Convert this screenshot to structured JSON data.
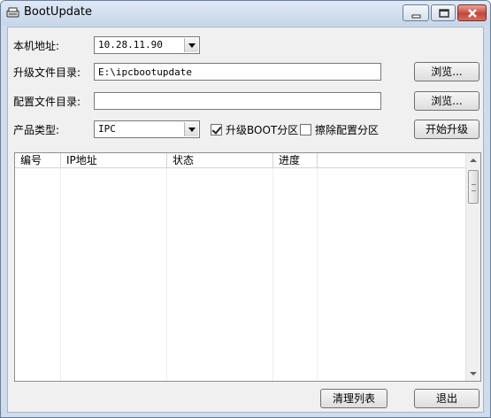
{
  "window": {
    "title": "BootUpdate"
  },
  "form": {
    "local_address_label": "本机地址:",
    "local_address_value": "10.28.11.90",
    "upgrade_dir_label": "升级文件目录:",
    "upgrade_dir_value": "E:\\ipcbootupdate",
    "config_dir_label": "配置文件目录:",
    "config_dir_value": "",
    "browse_label": "浏览...",
    "product_type_label": "产品类型:",
    "product_type_value": "IPC",
    "upgrade_boot_label": "升级BOOT分区",
    "upgrade_boot_checked": true,
    "erase_config_label": "擦除配置分区",
    "erase_config_checked": false,
    "start_upgrade_label": "开始升级"
  },
  "list": {
    "columns": [
      "编号",
      "IP地址",
      "状态",
      "进度"
    ],
    "rows": []
  },
  "footer": {
    "clear_list_label": "清理列表",
    "exit_label": "退出"
  }
}
